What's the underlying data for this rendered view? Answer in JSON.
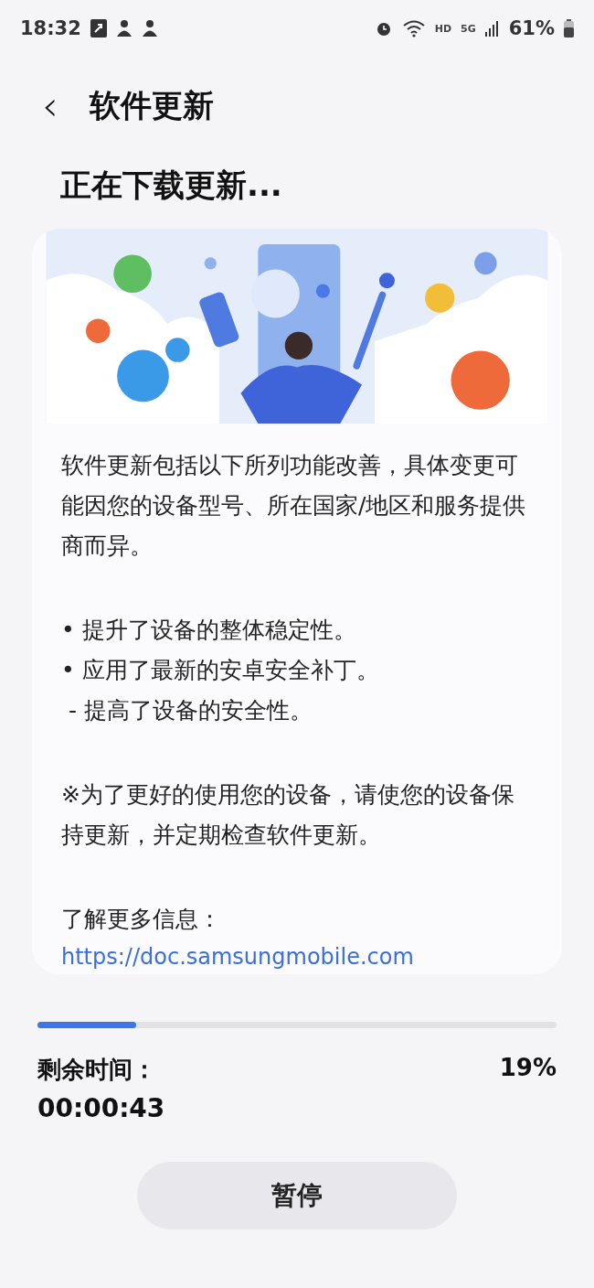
{
  "status_bar": {
    "time": "18:32",
    "network_labels": [
      "HD",
      "5G"
    ],
    "battery": "61%"
  },
  "header": {
    "back": "‹",
    "title": "软件更新"
  },
  "heading": "正在下载更新...",
  "card": {
    "paragraphs": [
      "软件更新包括以下所列功能改善，具体变更可能因您的设备型号、所在国家/地区和服务提供商而异。",
      "• 提升了设备的整体稳定性。\n• 应用了最新的安卓安全补丁。\n - 提高了设备的安全性。",
      "※为了更好的使用您的设备，请使您的设备保持更新，并定期检查软件更新。",
      "了解更多信息："
    ],
    "link": "https://doc.samsungmobile.com"
  },
  "progress": {
    "level": 0.19,
    "remaining_label": "剩余时间：",
    "remaining_time": "00:00:43",
    "percent": "19%"
  },
  "pause_button": "暂停"
}
